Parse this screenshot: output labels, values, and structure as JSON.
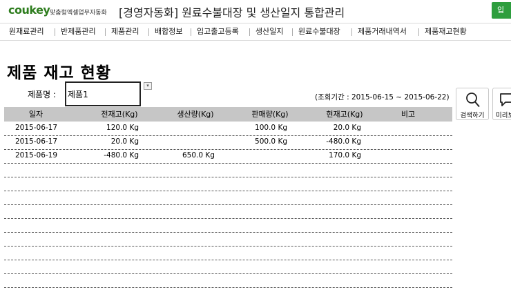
{
  "header": {
    "logo": "coukey",
    "logo_sub": "맞춤형엑셀업무자동화",
    "title": "[경영자동화] 원료수불대장 및 생산일지 통합관리",
    "corner_button": "입"
  },
  "menu": [
    "원재료관리",
    "반제품관리",
    "제품관리",
    "배합정보",
    "입고출고등록",
    "생산일지",
    "원료수불대장",
    "제품거래내역서",
    "제품재고현황"
  ],
  "page": {
    "title": "제품 재고 현황",
    "product_label": "제품명 :",
    "product_value": "제품1",
    "dropdown_glyph": "▾",
    "period": "(조회기간 : 2015-06-15 ~ 2015-06-22)"
  },
  "buttons": {
    "search": "검색하기",
    "preview": "미리보기"
  },
  "table": {
    "columns": [
      "일자",
      "전재고(Kg)",
      "생산량(Kg)",
      "판매량(Kg)",
      "현재고(Kg)",
      "비고"
    ],
    "rows": [
      {
        "date": "2015-06-17",
        "prev": "120.0 Kg",
        "prod": "",
        "sale": "100.0 Kg",
        "curr": "20.0 Kg",
        "note": ""
      },
      {
        "date": "2015-06-17",
        "prev": "20.0 Kg",
        "prod": "",
        "sale": "500.0 Kg",
        "curr": "-480.0 Kg",
        "note": ""
      },
      {
        "date": "2015-06-19",
        "prev": "-480.0 Kg",
        "prod": "650.0 Kg",
        "sale": "",
        "curr": "170.0 Kg",
        "note": ""
      },
      {
        "date": "",
        "prev": "",
        "prod": "",
        "sale": "",
        "curr": "",
        "note": ""
      },
      {
        "date": "",
        "prev": "",
        "prod": "",
        "sale": "",
        "curr": "",
        "note": ""
      },
      {
        "date": "",
        "prev": "",
        "prod": "",
        "sale": "",
        "curr": "",
        "note": ""
      },
      {
        "date": "",
        "prev": "",
        "prod": "",
        "sale": "",
        "curr": "",
        "note": ""
      },
      {
        "date": "",
        "prev": "",
        "prod": "",
        "sale": "",
        "curr": "",
        "note": ""
      },
      {
        "date": "",
        "prev": "",
        "prod": "",
        "sale": "",
        "curr": "",
        "note": ""
      },
      {
        "date": "",
        "prev": "",
        "prod": "",
        "sale": "",
        "curr": "",
        "note": ""
      },
      {
        "date": "",
        "prev": "",
        "prod": "",
        "sale": "",
        "curr": "",
        "note": ""
      },
      {
        "date": "",
        "prev": "",
        "prod": "",
        "sale": "",
        "curr": "",
        "note": ""
      }
    ]
  },
  "colors": {
    "brand_green": "#2e7d1e",
    "header_gray": "#c6c6c6"
  }
}
